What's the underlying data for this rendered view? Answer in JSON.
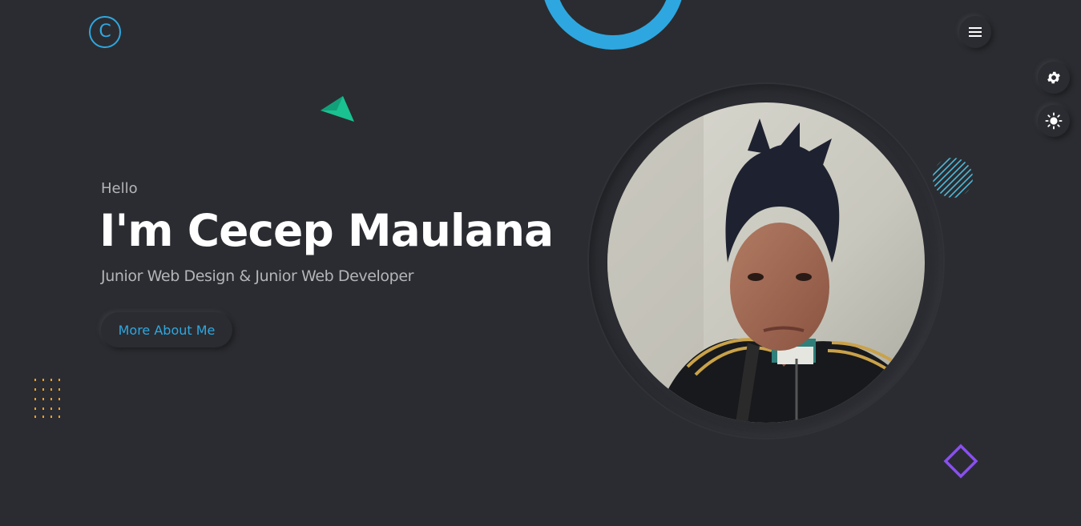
{
  "header": {
    "logo_letter": "C"
  },
  "hero": {
    "greeting": "Hello",
    "name": "I'm Cecep Maulana",
    "role": "Junior Web Design & Junior Web Developer",
    "cta_label": "More About Me"
  },
  "icons": {
    "menu": "hamburger-icon",
    "settings": "gear-icon",
    "theme": "sun-icon"
  },
  "colors": {
    "background": "#2b2c31",
    "accent": "#2ea7e0",
    "triangle": "#19c290",
    "dots": "#f0a020",
    "diamond": "#8a4ff0",
    "stripes": "#4fb9d9"
  }
}
